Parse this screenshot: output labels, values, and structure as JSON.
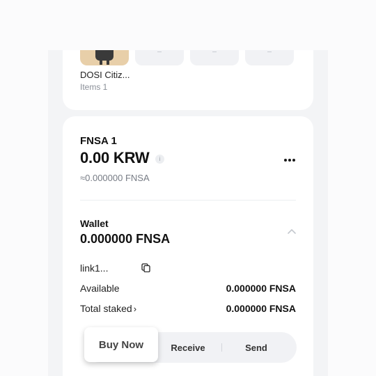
{
  "nft_section": {
    "item_name": "DOSI Citiz...",
    "item_count": "Items 1"
  },
  "asset": {
    "name": "FNSA 1",
    "value": "0.00 KRW",
    "approx": "≈0.000000 FNSA"
  },
  "wallet": {
    "label": "Wallet",
    "balance": "0.000000 FNSA",
    "address": "link1...",
    "available_label": "Available",
    "available_value": "0.000000 FNSA",
    "staked_label": "Total staked",
    "staked_value": "0.000000 FNSA"
  },
  "actions": {
    "buy_label": "Buy Now",
    "receive_label": "Receive",
    "send_label": "Send"
  },
  "icons": {
    "info": "info-icon",
    "more": "more-icon",
    "collapse": "chevron-up-icon",
    "copy": "copy-icon",
    "staked_detail": "chevron-right-icon"
  },
  "colors": {
    "background": "#f3f4f6",
    "card": "#ffffff",
    "muted_text": "#8a8f98",
    "action_bar": "#f1f2f5"
  }
}
